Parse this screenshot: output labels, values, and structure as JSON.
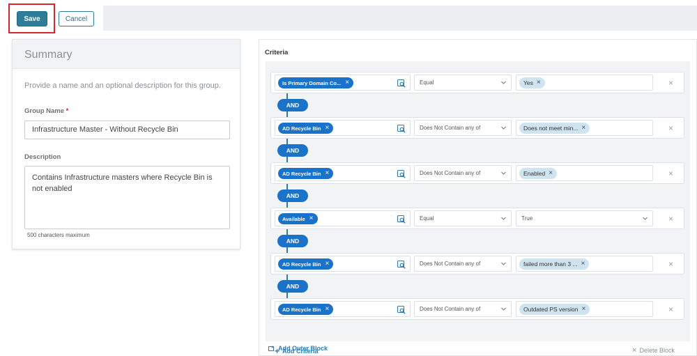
{
  "toolbar": {
    "save_label": "Save",
    "cancel_label": "Cancel"
  },
  "summary": {
    "title": "Summary",
    "description": "Provide a name and an optional description for this group.",
    "group_name_label": "Group Name",
    "required_marker": "*",
    "group_name_value": "Infrastructure Master - Without Recycle Bin",
    "description_label": "Description",
    "description_value": "Contains Infrastructure masters where Recycle Bin is not enabled",
    "description_hint": "500 characters maximum"
  },
  "criteria": {
    "title": "Criteria",
    "connector_label": "AND",
    "rows": [
      {
        "field": "Is Primary Domain Co...",
        "operator": "Equal",
        "value_chip": "Yes"
      },
      {
        "field": "AD Recycle Bin",
        "operator": "Does Not Contain any of",
        "value_chip": "Does not meet min..."
      },
      {
        "field": "AD Recycle Bin",
        "operator": "Does Not Contain any of",
        "value_chip": "Enabled"
      },
      {
        "field": "Available",
        "operator": "Equal",
        "value_select": "True"
      },
      {
        "field": "AD Recycle Bin",
        "operator": "Does Not Contain any of",
        "value_chip": "failed more than 3 ..."
      },
      {
        "field": "AD Recycle Bin",
        "operator": "Does Not Contain any of",
        "value_chip": "Outdated PS version"
      }
    ],
    "add_criteria_label": "Add Criteria",
    "delete_block_label": "Delete Block",
    "add_outer_block_label": "Add Outer Block"
  },
  "colors": {
    "primary": "#2f7d98",
    "chip_blue": "#1a73c8",
    "value_chip": "#cfe4ee",
    "highlight_border": "#d9262e"
  },
  "icons": [
    "search-filter-icon",
    "chevron-down-icon",
    "close-icon",
    "plus-icon",
    "add-block-icon"
  ]
}
